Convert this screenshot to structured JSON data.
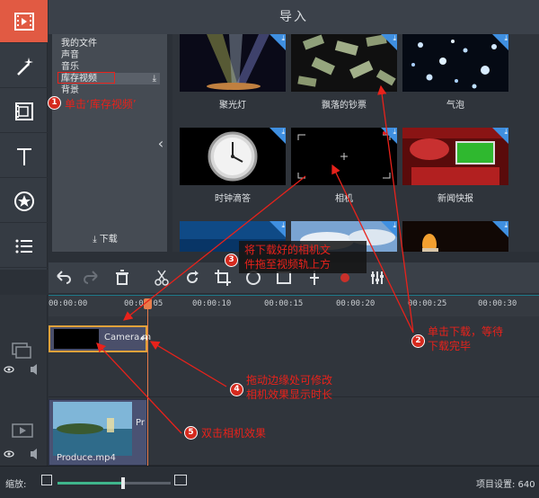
{
  "header": {
    "title": "导入"
  },
  "categories": [
    {
      "label": "我的文件"
    },
    {
      "label": "声音"
    },
    {
      "label": "音乐"
    },
    {
      "label": "库存视频",
      "selected": true
    },
    {
      "label": "背景"
    }
  ],
  "category_download_icon": "download-icon",
  "download_button": {
    "label": "下载"
  },
  "thumbnails": [
    {
      "label": "聚光灯"
    },
    {
      "label": "飘落的钞票"
    },
    {
      "label": "气泡"
    },
    {
      "label": "时钟滴答"
    },
    {
      "label": "相机"
    },
    {
      "label": "新闻快报"
    }
  ],
  "timeline": {
    "ticks": [
      "00:00:00",
      "00:00:05",
      "00:00:10",
      "00:00:15",
      "00:00:20",
      "00:00:25",
      "00:00:30"
    ],
    "camera_clip": {
      "name": "Camera.m"
    },
    "video_clip": {
      "name": "Produce.mp4",
      "short": "Pr"
    }
  },
  "bottombar": {
    "zoom_label": "缩放:",
    "zoom_level": 0.58,
    "project_settings": "项目设置: 640"
  },
  "annotations": {
    "step1": {
      "num": "1",
      "text": "单击‘库存视频’"
    },
    "step2": {
      "num": "2",
      "line1": "单击下载，等待",
      "line2": "下载完毕"
    },
    "step3": {
      "num": "3",
      "line1": "将下载好的相机文",
      "line2": "件拖至视频轨上方"
    },
    "step4": {
      "num": "4",
      "line1": "拖动边缘处可修改",
      "line2": "相机效果显示时长"
    },
    "step5": {
      "num": "5",
      "text": "双击相机效果"
    }
  },
  "colors": {
    "accent": "#e15a43",
    "annotation": "#e8221b",
    "download_badge": "#3f8fe0",
    "clip_border": "#e0a23a"
  }
}
